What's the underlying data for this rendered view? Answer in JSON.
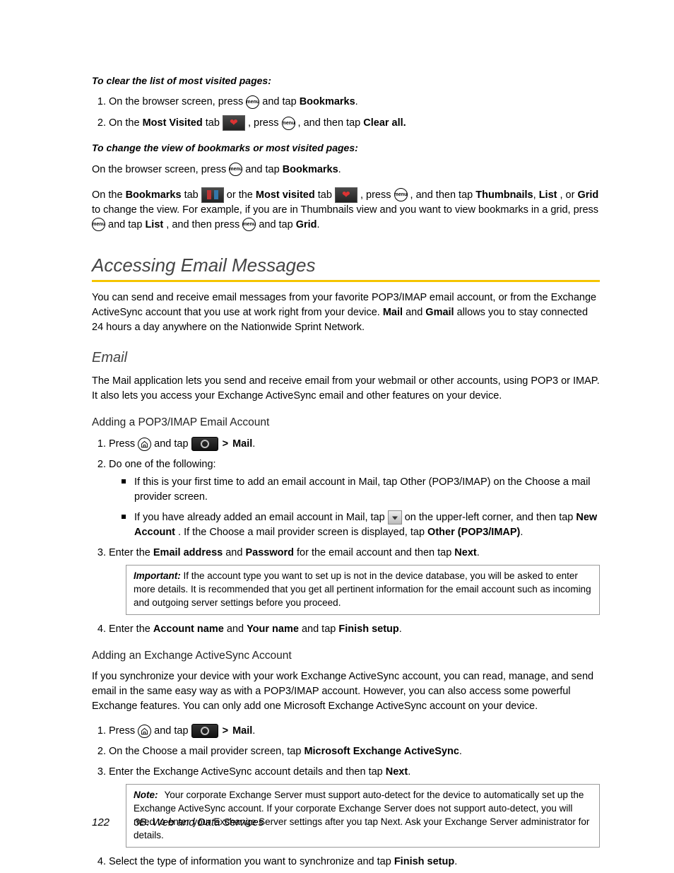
{
  "head1": "To clear the list of most visited pages:",
  "s1": {
    "a1": "On the browser screen, press ",
    "a2": " and tap ",
    "a3": "Bookmarks",
    "b1": "On the ",
    "b2": "Most Visited",
    "b3": " tab ",
    "b4": ", press ",
    "b5": ", and then tap ",
    "b6": "Clear all."
  },
  "head2": "To change the view of bookmarks or most visited pages:",
  "p1a": "On the browser screen, press ",
  "p1b": " and tap ",
  "p1c": "Bookmarks",
  "p2": {
    "a": "On the ",
    "b": "Bookmarks",
    "c": " tab ",
    "d": " or the ",
    "e": "Most visited",
    "f": " tab ",
    "g": ", press ",
    "h": ", and then tap ",
    "i": "Thumbnails",
    "j": "List",
    "k": ", or ",
    "l": "Grid",
    "m": " to change the view. For example, if you are in Thumbnails view and you want to view bookmarks in a grid, press ",
    "n": " and tap ",
    "o": "List",
    "p": ", and then press ",
    "q": " and tap ",
    "r": "Grid"
  },
  "h2": "Accessing Email Messages",
  "intro": {
    "a": "You can send and receive email messages from your favorite POP3/IMAP email account, or from the Exchange ActiveSync account that you use at work right from your device. ",
    "b": "Mail",
    "c": " and ",
    "d": "Gmail",
    "e": " allows you to stay connected 24 hours a day anywhere on the Nationwide Sprint Network."
  },
  "h3": "Email",
  "emailP": "The Mail application lets you send and receive email from your webmail or other accounts, using POP3 or IMAP. It also lets you access your Exchange ActiveSync email and other features on your device.",
  "h4a": "Adding a POP3/IMAP Email Account",
  "pop": {
    "s1a": "Press ",
    "s1b": " and tap ",
    "gt": ">",
    "mail": "Mail",
    "s2": "Do one of the following:",
    "b1": "If this is your first time to add an email account in Mail, tap Other (POP3/IMAP) on the Choose a mail provider screen.",
    "b2a": "If you have already added an email account in Mail, tap ",
    "b2b": " on the upper-left corner, and then tap ",
    "b2c": "New Account",
    "b2d": ". If the Choose a mail provider screen is displayed, tap ",
    "b2e": "Other (POP3/IMAP)",
    "s3a": "Enter the ",
    "s3b": "Email address",
    "s3c": " and ",
    "s3d": "Password",
    "s3e": " for the email account and then tap ",
    "s3f": "Next",
    "imp_label": "Important:",
    "imp": "If the account type you want to set up is not in the device database, you will be asked to enter more details. It is recommended that you get all pertinent information for the email account such as incoming and outgoing server settings before you proceed.",
    "s4a": "Enter the ",
    "s4b": "Account name",
    "s4c": " and ",
    "s4d": "Your name",
    "s4e": " and tap ",
    "s4f": "Finish setup"
  },
  "h4b": "Adding an Exchange ActiveSync Account",
  "exP": "If you synchronize your device with your work Exchange ActiveSync account, you can read, manage, and send email in the same easy way as with a POP3/IMAP account. However, you can also access some powerful Exchange features. You can only add one Microsoft Exchange ActiveSync account on your device.",
  "ex": {
    "s1a": "Press ",
    "s1b": " and tap ",
    "gt": ">",
    "mail": "Mail",
    "s2a": "On the Choose a mail provider screen, tap ",
    "s2b": "Microsoft Exchange ActiveSync",
    "s3a": "Enter the Exchange ActiveSync account details and then tap ",
    "s3b": "Next",
    "note_label": "Note:",
    "note": "Your corporate Exchange Server must support auto-detect for the device to automatically set up the Exchange ActiveSync account. If your corporate Exchange Server does not support auto-detect, you will need to enter your Exchange Server settings after you tap Next. Ask your Exchange Server administrator for details.",
    "s4a": "Select the type of information you want to synchronize and tap ",
    "s4b": "Finish setup"
  },
  "footer": {
    "page": "122",
    "section": "3B. Web and Data Services"
  }
}
